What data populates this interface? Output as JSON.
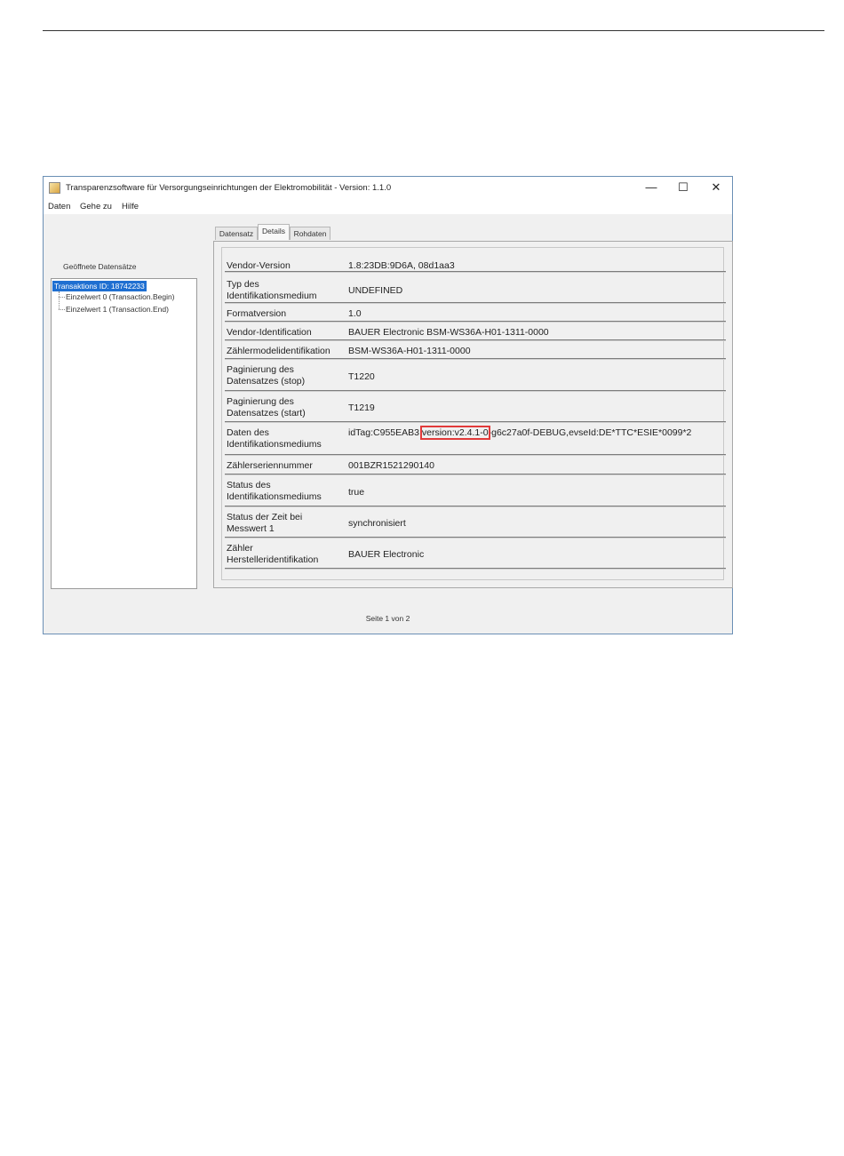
{
  "window": {
    "title": "Transparenzsoftware für Versorgungseinrichtungen der Elektromobilität - Version: 1.1.0",
    "controls": {
      "minimize": "—",
      "maximize": "☐",
      "close": "✕"
    }
  },
  "menu": [
    "Daten",
    "Gehe zu",
    "Hilfe"
  ],
  "left_panel": {
    "label": "Geöffnete Datensätze",
    "tree": {
      "root": "Transaktions ID: 18742233",
      "children": [
        "Einzelwert 0 (Transaction.Begin)",
        "Einzelwert 1 (Transaction.End)"
      ]
    }
  },
  "tabs": [
    "Datensatz",
    "Details",
    "Rohdaten"
  ],
  "active_tab": "Details",
  "details": [
    {
      "label": "Vendor-Version",
      "value": "1.8:23DB:9D6A, 08d1aa3"
    },
    {
      "label": "Typ des Identifikationsmedium",
      "value": "UNDEFINED"
    },
    {
      "label": "Formatversion",
      "value": "1.0"
    },
    {
      "label": "Vendor-Identification",
      "value": "BAUER Electronic BSM-WS36A-H01-1311-0000"
    },
    {
      "label": "Zählermodelidentifikation",
      "value": "BSM-WS36A-H01-1311-0000"
    },
    {
      "label": "Paginierung des Datensatzes (stop)",
      "value": "T1220"
    },
    {
      "label": "Paginierung des Datensatzes (start)",
      "value": "T1219"
    },
    {
      "label": "Daten des Identifikationsmediums",
      "value_before": "idTag:C955EAB3,",
      "value_highlight": "version:v2.4.1-0",
      "value_after": "-g6c27a0f-DEBUG,evseId:DE*TTC*ESIE*0099*2"
    },
    {
      "label": "Zählerseriennummer",
      "value": "001BZR1521290140"
    },
    {
      "label": "Status des Identifikationsmediums",
      "value": "true"
    },
    {
      "label": "Status der Zeit bei Messwert 1",
      "value": "synchronisiert"
    },
    {
      "label": "Zähler Herstelleridentifikation",
      "value": "BAUER Electronic"
    }
  ],
  "status_bar": "Seite 1 von 2",
  "colors": {
    "selection": "#1f6fd1",
    "highlight_box": "#e23b3b"
  }
}
